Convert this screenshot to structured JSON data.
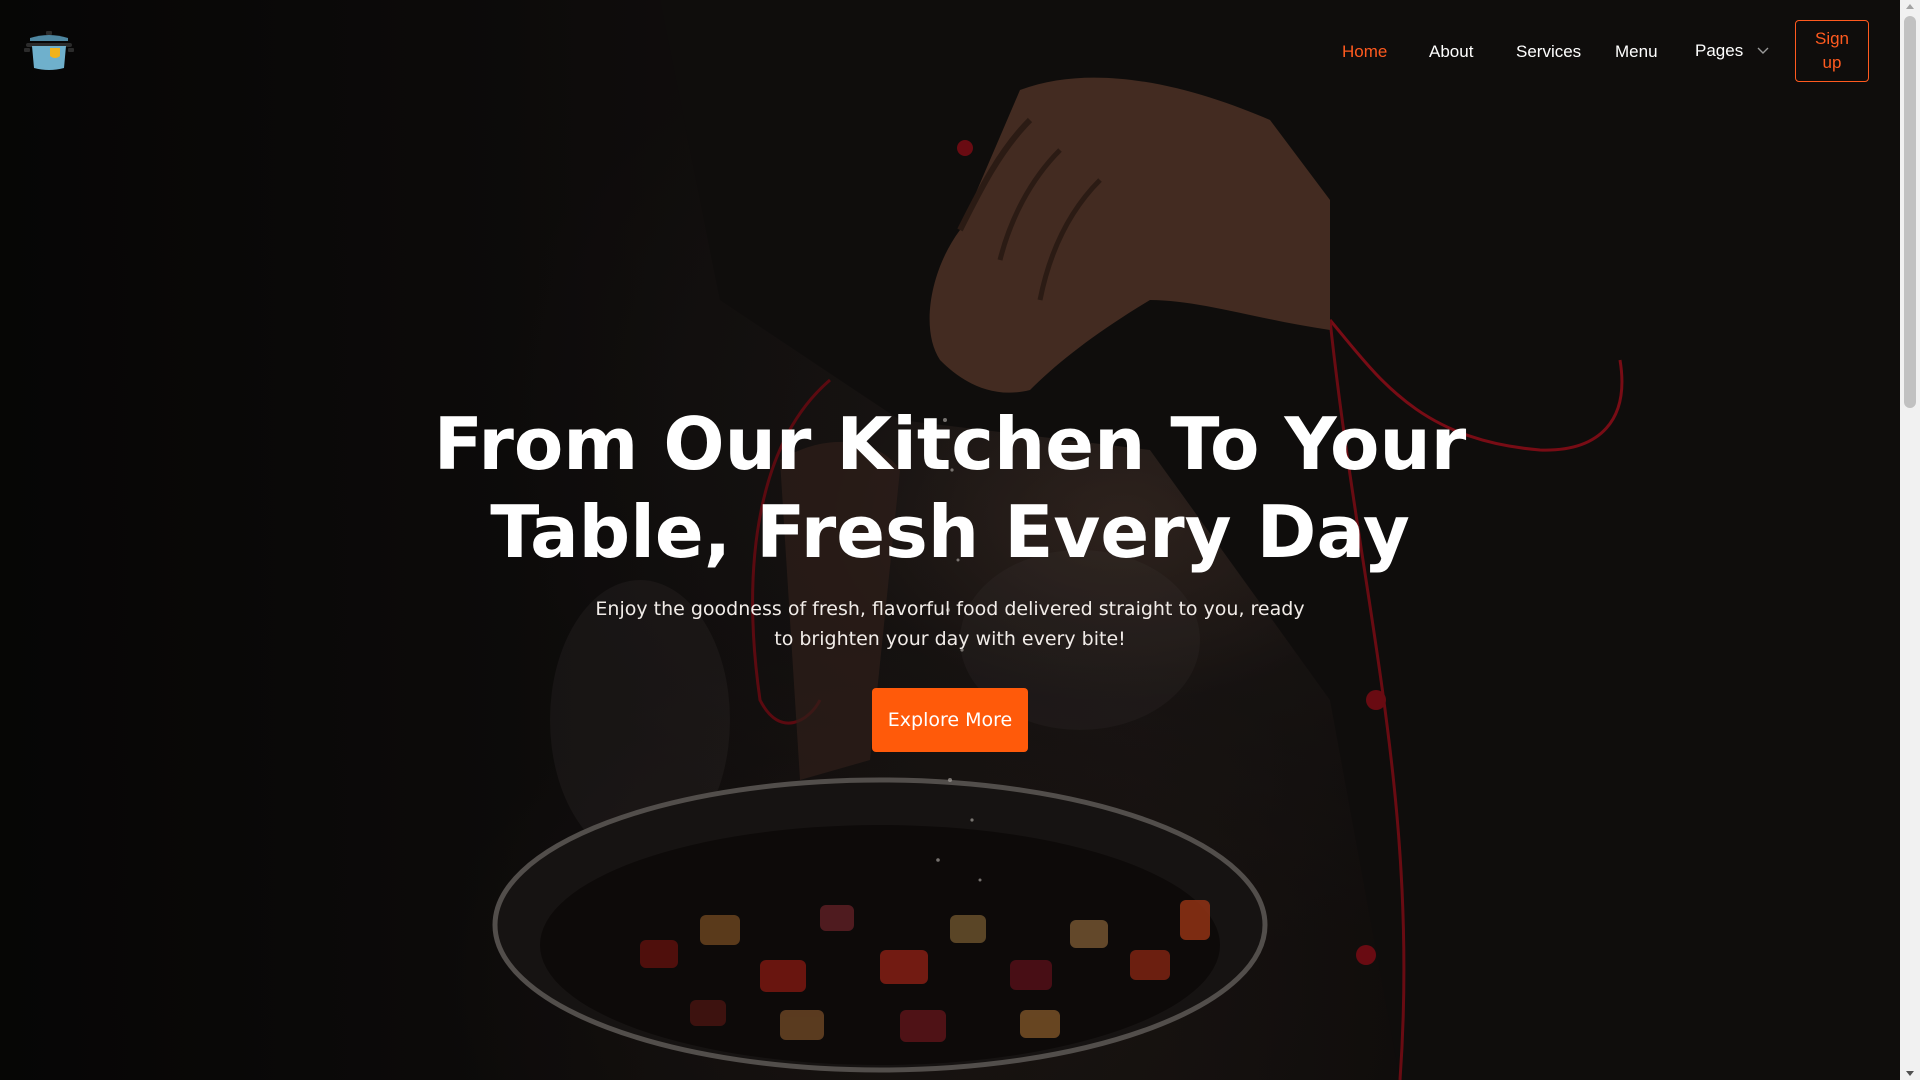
{
  "header": {
    "logo_icon": "cooking-pot-icon",
    "nav": [
      {
        "label": "Home",
        "active": true
      },
      {
        "label": "About",
        "active": false
      },
      {
        "label": "Services",
        "active": false
      },
      {
        "label": "Menu",
        "active": false
      },
      {
        "label": "Pages",
        "active": false,
        "has_dropdown": true,
        "icon": "chevron-down-icon"
      }
    ],
    "signup_label": "Sign up"
  },
  "hero": {
    "title": "From Our Kitchen To Your Table, Fresh Every Day",
    "subtitle": "Enjoy the goodness of fresh, flavorful food delivered straight to you, ready to brighten your day with every bite!",
    "cta_label": "Explore More",
    "background_image": "chef-seasoning-pan-photo"
  },
  "colors": {
    "accent": "#ff5a1f",
    "button": "#ff5a0a",
    "text": "#ffffff",
    "background": "#0b0908"
  }
}
